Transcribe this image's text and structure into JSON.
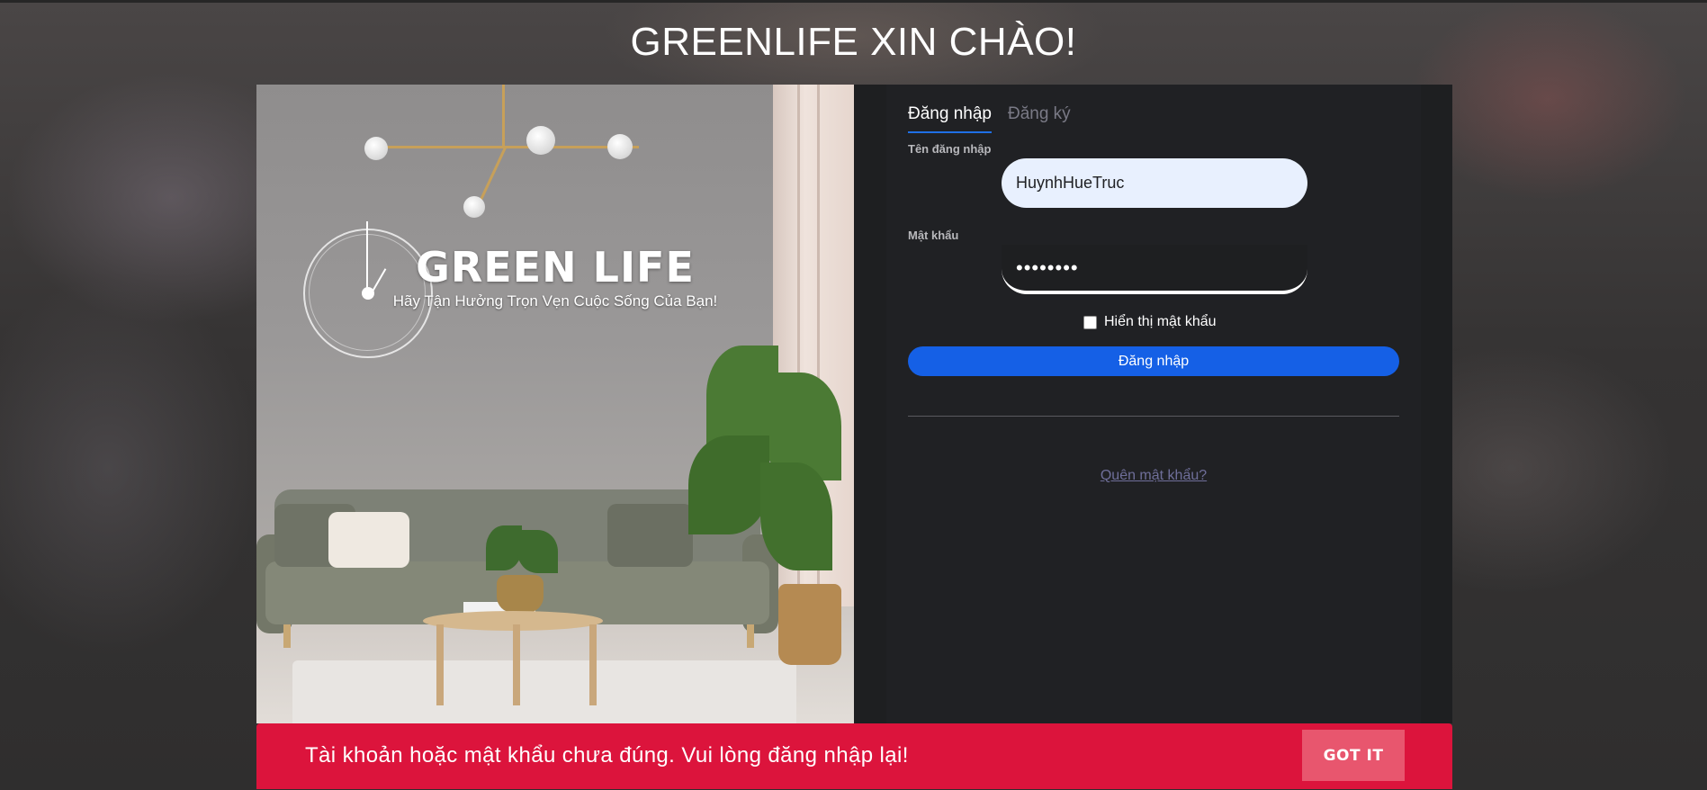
{
  "page": {
    "title": "GREENLIFE XIN CHÀO!"
  },
  "hero": {
    "logo": "GREEN LIFE",
    "tagline": "Hãy Tận Hưởng Trọn Vẹn Cuộc Sống Của Bạn!"
  },
  "auth": {
    "tabs": [
      {
        "label": "Đăng nhập",
        "active": true
      },
      {
        "label": "Đăng ký",
        "active": false
      }
    ],
    "username": {
      "label": "Tên đăng nhập",
      "value": "HuynhHueTruc"
    },
    "password": {
      "label": "Mật khẩu",
      "value": "••••••••"
    },
    "show_password": {
      "label": "Hiển thị mật khẩu",
      "checked": false
    },
    "submit_label": "Đăng nhập",
    "forgot_label": "Quên mật khẩu?"
  },
  "toast": {
    "message": "Tài khoản hoặc mật khẩu chưa đúng. Vui lòng đăng nhập lại!",
    "button_label": "GOT IT",
    "color": "#dc143c"
  },
  "colors": {
    "accent": "#1560e6",
    "panel": "#1e1f21"
  }
}
